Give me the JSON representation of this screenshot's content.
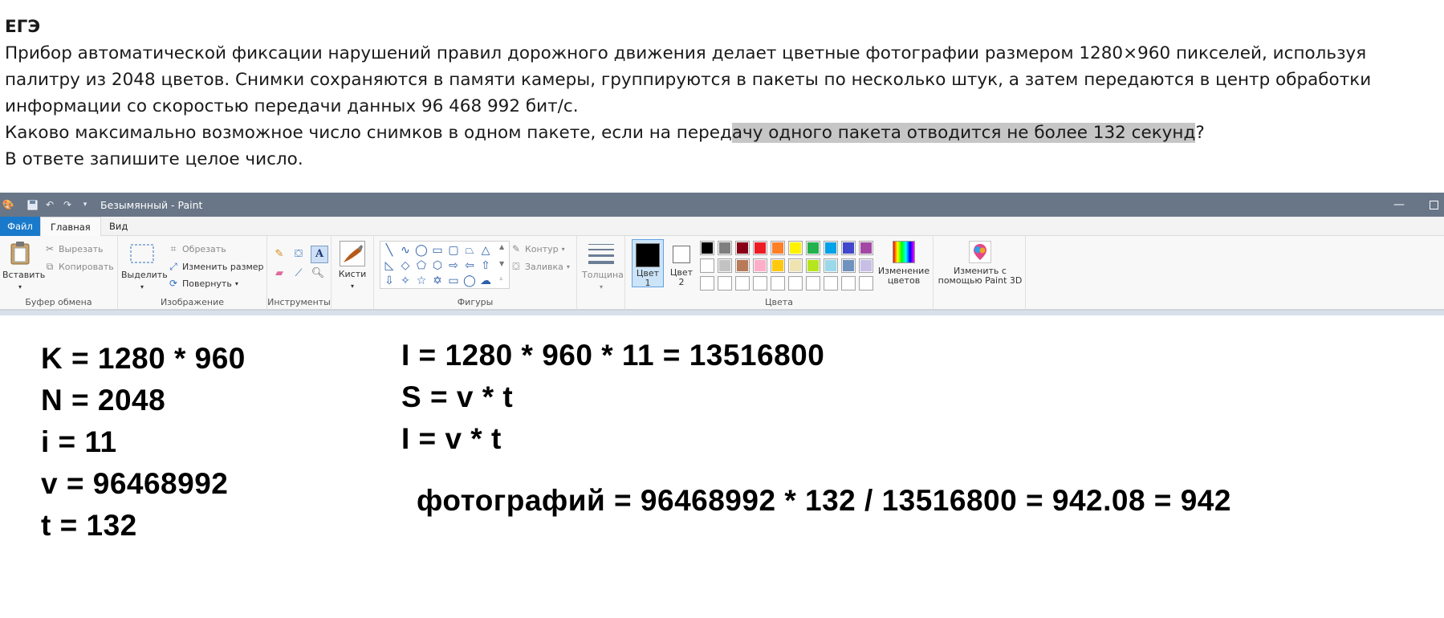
{
  "task": {
    "heading": "ЕГЭ",
    "lines": [
      "Прибор автоматической фиксации нарушений правил дорожного движения делает цветные фотографии размером 1280×960 пикселей, используя",
      "палитру из 2048 цветов. Снимки сохраняются в памяти камеры, группируются в пакеты по несколько штук, а затем передаются в центр обработки",
      "информации со скоростью передачи данных 96 468 992 бит/с."
    ],
    "question_before": "Каково максимально возможное число снимков в одном пакете, если на перед",
    "question_highlight": "ачу одного пакета отводится не более 132 секунд",
    "question_after": "?",
    "answer_note": "В ответе запишите целое число."
  },
  "window": {
    "title": "Безымянный - Paint"
  },
  "tabs": {
    "file": "Файл",
    "home": "Главная",
    "view": "Вид"
  },
  "ribbon": {
    "clipboard": {
      "label": "Буфер обмена",
      "paste": "Вставить",
      "cut": "Вырезать",
      "copy": "Копировать"
    },
    "image": {
      "label": "Изображение",
      "select": "Выделить",
      "crop": "Обрезать",
      "resize": "Изменить размер",
      "rotate": "Повернуть"
    },
    "tools": {
      "label": "Инструменты"
    },
    "brushes": {
      "label": "Кисти"
    },
    "shapes": {
      "label": "Фигуры",
      "outline": "Контур",
      "fill": "Заливка"
    },
    "size": {
      "label": "Толщина"
    },
    "colors": {
      "label": "Цвета",
      "color1_l1": "Цвет",
      "color1_l2": "1",
      "color2_l1": "Цвет",
      "color2_l2": "2",
      "edit_l1": "Изменение",
      "edit_l2": "цветов",
      "palette_row1": [
        "#000000",
        "#7f7f7f",
        "#880015",
        "#ed1c24",
        "#ff7f27",
        "#fff200",
        "#22b14c",
        "#00a2e8",
        "#3f48cc",
        "#a349a4"
      ],
      "palette_row2": [
        "#ffffff",
        "#c3c3c3",
        "#b97a57",
        "#ffaec9",
        "#ffc90e",
        "#efe4b0",
        "#b5e61d",
        "#99d9ea",
        "#7092be",
        "#c8bfe7"
      ],
      "palette_row3": [
        "#ffffff",
        "#ffffff",
        "#ffffff",
        "#ffffff",
        "#ffffff",
        "#ffffff",
        "#ffffff",
        "#ffffff",
        "#ffffff",
        "#ffffff"
      ]
    },
    "paint3d": {
      "l1": "Изменить с",
      "l2": "помощью Paint 3D"
    }
  },
  "canvas": {
    "k": "K = 1280 * 960",
    "n": "N = 2048",
    "i": "i = 11",
    "v": "v = 96468992",
    "t": "t = 132",
    "volume": "I = 1280 * 960 * 11 = 13516800",
    "s_eq": "S = v * t",
    "i_eq": "I = v * t",
    "result": "фотографий = 96468992 * 132 / 13516800 =  942.08 = 942"
  }
}
